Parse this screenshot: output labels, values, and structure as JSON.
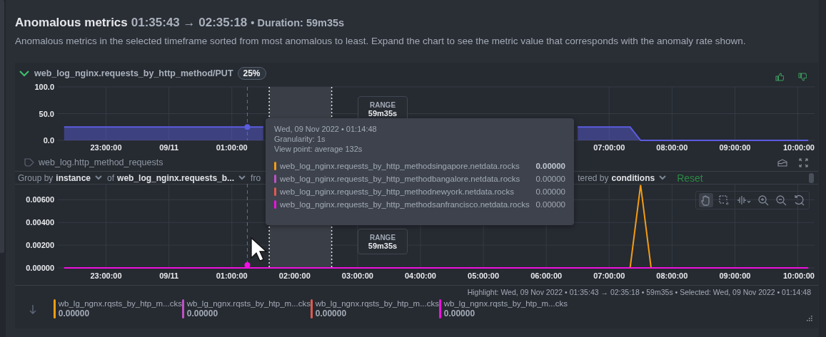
{
  "header": {
    "title": "Anomalous metrics",
    "range": "01:35:43 → 02:35:18",
    "duration": "• Duration: 59m35s",
    "description": "Anomalous metrics in the selected timeframe sorted from most anomalous to least. Expand the chart to see the metric value that corresponds with the anomaly rate shown."
  },
  "metric": {
    "expanded": true,
    "name": "web_log_nginx.requests_by_http_method/PUT",
    "anomaly_rate": "25%"
  },
  "anomaly_chart": {
    "range_label": "RANGE",
    "range_value": "59m35s",
    "chart_data": {
      "type": "area",
      "ylim": [
        0,
        100
      ],
      "categories": [
        null,
        null,
        null,
        null,
        "23:00:00",
        null,
        null,
        null,
        null,
        null,
        "09/11",
        null,
        null,
        null,
        null,
        null,
        "01:00:00",
        null,
        null,
        null,
        null,
        null,
        null,
        null,
        null,
        null,
        null,
        null,
        null,
        null,
        null,
        null,
        null,
        null,
        null,
        null,
        null,
        null,
        null,
        null,
        null,
        null,
        null,
        null,
        null,
        null,
        null,
        null,
        null,
        null,
        null,
        null,
        "07:00:00",
        null,
        null,
        null,
        null,
        null,
        "08:00:00",
        null,
        null,
        null,
        null,
        null,
        "09:00:00",
        null,
        null,
        null,
        null,
        null,
        "10:00:00",
        null
      ],
      "series": [
        {
          "color": "#5b5de0",
          "values": [
            25,
            25,
            25,
            25,
            25,
            25,
            25,
            25,
            25,
            25,
            25,
            25,
            25,
            25,
            25,
            25,
            25,
            25,
            25,
            25,
            null,
            null,
            null,
            null,
            null,
            null,
            null,
            null,
            null,
            null,
            null,
            null,
            null,
            null,
            null,
            null,
            null,
            null,
            null,
            null,
            null,
            null,
            null,
            null,
            null,
            null,
            null,
            null,
            null,
            25,
            25,
            25,
            25,
            25,
            25,
            0,
            0,
            0,
            0,
            0,
            0,
            0,
            0,
            0,
            0,
            0,
            0,
            0,
            0,
            0,
            0,
            0
          ]
        }
      ],
      "yticks": [
        {
          "value": 0,
          "label": "0.0"
        },
        {
          "value": 50,
          "label": "50.0"
        },
        {
          "value": 100,
          "label": "100.0"
        }
      ],
      "grid": true
    }
  },
  "context": {
    "name": "web_log.http_method_requests"
  },
  "filter_bar": {
    "group_by_label": "Group by",
    "group_by": "instance",
    "of_label": "of",
    "of_value": "web_log_nginx.requests_b...",
    "from_label": "fro",
    "filtered_label": "tered by",
    "filtered_value": "conditions",
    "reset": "Reset"
  },
  "value_chart": {
    "range_label": "RANGE",
    "range_value": "59m35s",
    "tools": [
      {
        "kind": "pan",
        "selected": true
      },
      {
        "kind": "select",
        "selected": false
      },
      {
        "kind": "highlight",
        "selected": false
      },
      {
        "kind": "zoom-in",
        "selected": false
      },
      {
        "kind": "zoom-out",
        "selected": false
      },
      {
        "kind": "reset",
        "selected": false
      }
    ],
    "chart_data": {
      "type": "line",
      "ylim": [
        0,
        0.0074
      ],
      "categories": [
        null,
        null,
        null,
        null,
        "23:00:00",
        null,
        null,
        null,
        null,
        null,
        "09/11",
        null,
        null,
        null,
        null,
        null,
        "01:00:00",
        null,
        null,
        null,
        null,
        null,
        "02:00:00",
        null,
        null,
        null,
        null,
        null,
        "03:00:00",
        null,
        null,
        null,
        null,
        null,
        "04:00:00",
        null,
        null,
        null,
        null,
        null,
        "05:00:00",
        null,
        null,
        null,
        null,
        null,
        "06:00:00",
        null,
        null,
        null,
        null,
        null,
        "07:00:00",
        null,
        null,
        null,
        null,
        null,
        "08:00:00",
        null,
        null,
        null,
        null,
        null,
        "09:00:00",
        null,
        null,
        null,
        null,
        null,
        "10:00:00",
        null
      ],
      "series": [
        {
          "color": "#f39c12",
          "values": [
            null,
            null,
            null,
            null,
            null,
            null,
            null,
            null,
            null,
            null,
            null,
            null,
            null,
            null,
            null,
            null,
            null,
            null,
            null,
            null,
            null,
            null,
            null,
            null,
            null,
            null,
            null,
            null,
            null,
            null,
            null,
            null,
            null,
            null,
            null,
            null,
            null,
            null,
            null,
            null,
            null,
            null,
            null,
            null,
            null,
            null,
            null,
            null,
            null,
            null,
            null,
            null,
            null,
            null,
            0,
            0.0073,
            0,
            null,
            null,
            null,
            null,
            null,
            null,
            null,
            null,
            null,
            null,
            null,
            null,
            null,
            null,
            null
          ]
        },
        {
          "color": "#f010e0",
          "values": [
            0,
            0,
            0,
            0,
            0,
            0,
            0,
            0,
            0,
            0,
            0,
            0,
            0,
            0,
            0,
            0,
            0,
            0,
            0,
            0,
            0,
            0,
            0,
            0,
            0,
            0,
            0,
            0,
            0,
            0,
            0,
            0,
            0,
            0,
            0,
            0,
            0,
            0,
            0,
            0,
            0,
            0,
            0,
            0,
            0,
            0,
            0,
            0,
            0,
            0,
            0,
            0,
            0,
            0,
            0,
            0,
            0,
            0,
            0,
            0,
            0,
            0,
            0,
            0,
            0,
            0,
            0,
            0,
            0,
            0,
            0,
            0
          ]
        }
      ],
      "yticks": [
        {
          "value": 0,
          "label": "0.00000"
        },
        {
          "value": 0.002,
          "label": "0.00200"
        },
        {
          "value": 0.004,
          "label": "0.00400"
        },
        {
          "value": 0.006,
          "label": "0.00600"
        }
      ],
      "grid": true
    }
  },
  "tooltip": {
    "timestamp": "Wed, 09 Nov 2022 • 01:14:48",
    "granularity": "Granularity: 1s",
    "view_point": "View point: average 132s",
    "rows": [
      {
        "name": "web_log_nginx.requests_by_http_methodsingapore.netdata.rocks",
        "value": "0.00000",
        "color": "#f39c12",
        "selected": true
      },
      {
        "name": "web_log_nginx.requests_by_http_methodbangalore.netdata.rocks",
        "value": "0.00000",
        "color": "#c050c8",
        "selected": false
      },
      {
        "name": "web_log_nginx.requests_by_http_methodnewyork.netdata.rocks",
        "value": "0.00000",
        "color": "#e05a4e",
        "selected": false
      },
      {
        "name": "web_log_nginx.requests_by_http_methodsanfrancisco.netdata.rocks",
        "value": "0.00000",
        "color": "#f010e0",
        "selected": false
      }
    ]
  },
  "highlight_info": "Highlight: Wed, 09 Nov 2022 •  01:35:43 → 02:35:18  • 59m35s  •  Selected: Wed, 09 Nov 2022 • 01:14:48",
  "legend": [
    {
      "name": "wb_lg_ngnx.rqsts_by_htp_m...cks",
      "value": "0.00000",
      "color": "#f39c12"
    },
    {
      "name": "wb_lg_ngnx.rqsts_by_htp_m...cks",
      "value": "0.00000",
      "color": "#c050c8"
    },
    {
      "name": "wb_lg_ngnx.rqsts_by_htp_m...cks",
      "value": "0.00000",
      "color": "#e05a4e"
    },
    {
      "name": "wb_lg_ngnx.rqsts_by_htp_m...cks",
      "value": "0.00000",
      "color": "#f010e0"
    }
  ]
}
